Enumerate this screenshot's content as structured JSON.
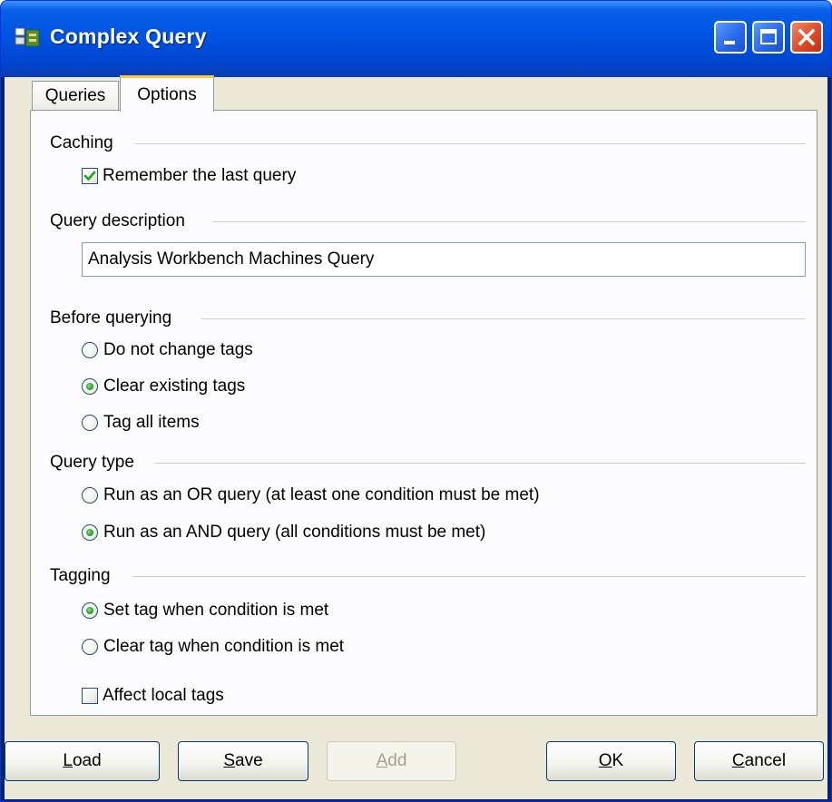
{
  "window": {
    "title": "Complex Query",
    "icons": [
      "app-icon",
      "minimize-icon",
      "maximize-icon",
      "close-icon"
    ]
  },
  "tabs": [
    {
      "label": "Queries",
      "active": false
    },
    {
      "label": "Options",
      "active": true
    }
  ],
  "caching": {
    "title": "Caching",
    "remember_label": "Remember the last query",
    "remember_checked": true
  },
  "description": {
    "title": "Query description",
    "value": "Analysis Workbench Machines Query"
  },
  "before_querying": {
    "title": "Before querying",
    "options": [
      {
        "label": "Do not change tags",
        "checked": false
      },
      {
        "label": "Clear existing tags",
        "checked": true
      },
      {
        "label": "Tag all items",
        "checked": false
      }
    ]
  },
  "query_type": {
    "title": "Query type",
    "options": [
      {
        "label": "Run as an OR query (at least one condition must be met)",
        "checked": false
      },
      {
        "label": "Run as an AND query (all conditions must be met)",
        "checked": true
      }
    ]
  },
  "tagging": {
    "title": "Tagging",
    "options": [
      {
        "label": "Set tag when condition is met",
        "checked": true
      },
      {
        "label": "Clear tag when condition is met",
        "checked": false
      }
    ],
    "affect_local_label": "Affect local tags",
    "affect_local_checked": false
  },
  "buttons": {
    "load": {
      "mnemonic": "L",
      "rest": "oad",
      "enabled": true
    },
    "save": {
      "mnemonic": "S",
      "rest": "ave",
      "enabled": true
    },
    "add": {
      "mnemonic": "A",
      "rest": "dd",
      "enabled": false
    },
    "ok": {
      "mnemonic": "O",
      "rest": "K",
      "enabled": true
    },
    "cancel": {
      "mnemonic": "C",
      "rest": "ancel",
      "enabled": true
    }
  },
  "colors": {
    "titlebar": "#0054e3",
    "face": "#ece9d8",
    "tab_highlight": "#ffc83c",
    "radio_dot": "#2c9f2c",
    "checkmark": "#21a121"
  }
}
